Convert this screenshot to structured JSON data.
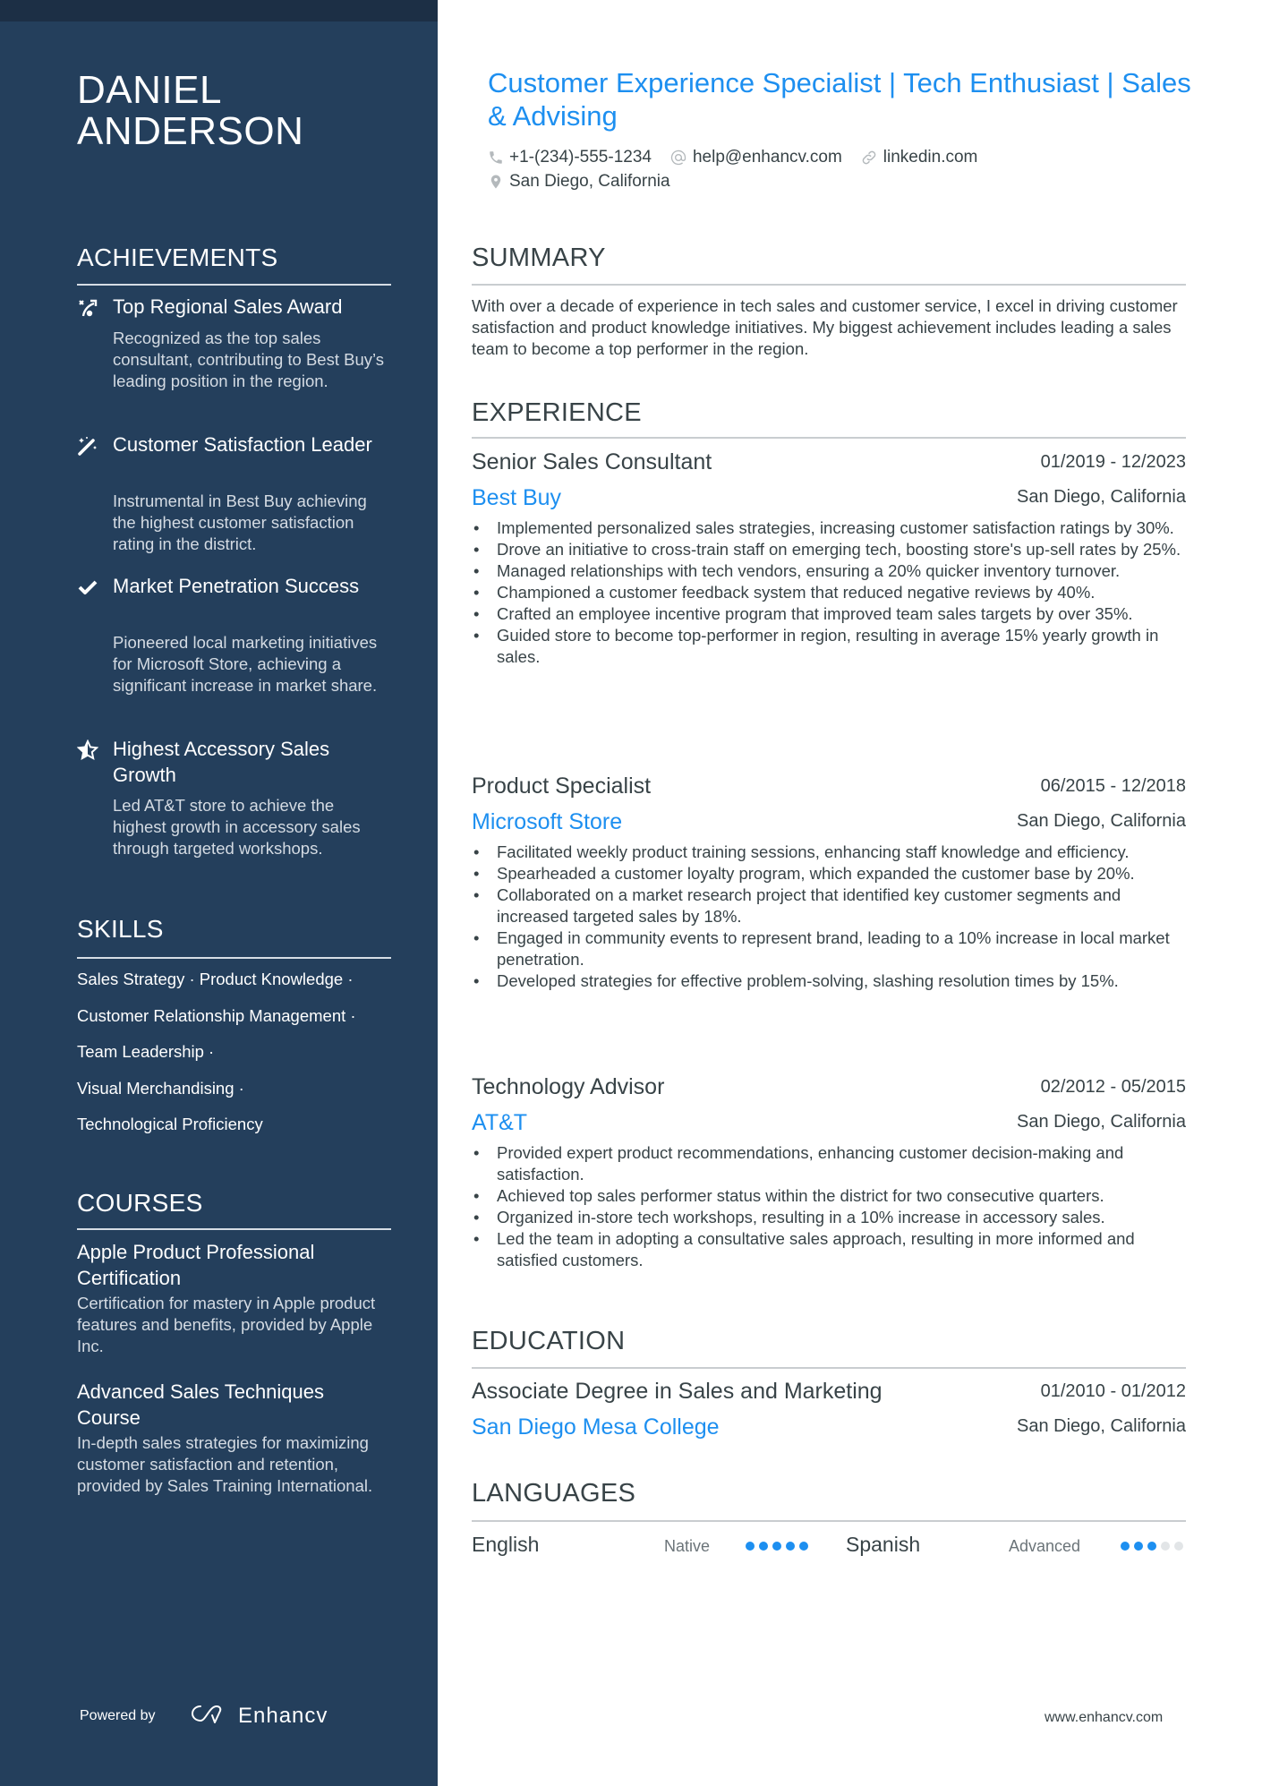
{
  "name": {
    "line1": "DANIEL",
    "line2": "ANDERSON"
  },
  "headline": "Customer Experience Specialist | Tech Enthusiast | Sales & Advising",
  "contact": {
    "phone": "+1-(234)-555-1234",
    "email": "help@enhancv.com",
    "link": "linkedin.com",
    "location": "San Diego, California",
    "icons": {
      "phone": "phone-icon",
      "email": "at-icon",
      "link": "link-icon",
      "location": "map-pin-icon"
    }
  },
  "sidebar": {
    "achievements": {
      "title": "ACHIEVEMENTS",
      "items": [
        {
          "icon": "strategy-icon",
          "title": "Top Regional Sales Award",
          "desc": "Recognized as the top sales consultant, contributing to Best Buy’s leading position in the region."
        },
        {
          "icon": "magic-wand-icon",
          "title": "Customer Satisfaction Leader",
          "desc": "Instrumental in Best Buy achieving the highest customer satisfaction rating in the district."
        },
        {
          "icon": "check-icon",
          "title": "Market Penetration Success",
          "desc": "Pioneered local marketing initiatives for Microsoft Store, achieving a significant increase in market share."
        },
        {
          "icon": "star-half-icon",
          "title": "Highest Accessory Sales Growth",
          "desc": "Led AT&T store to achieve the highest growth in accessory sales through targeted workshops."
        }
      ]
    },
    "skills": {
      "title": "SKILLS",
      "lines": [
        "Sales Strategy · Product Knowledge ·",
        "Customer Relationship Management ·",
        "Team Leadership ·",
        "Visual Merchandising ·",
        "Technological Proficiency"
      ]
    },
    "courses": {
      "title": "COURSES",
      "items": [
        {
          "title": "Apple Product Professional Certification",
          "desc": "Certification for mastery in Apple product features and benefits, provided by Apple Inc."
        },
        {
          "title": "Advanced Sales Techniques Course",
          "desc": "In-depth sales strategies for maximizing customer satisfaction and retention, provided by Sales Training International."
        }
      ]
    },
    "powered_by": "Powered by",
    "brand": "Enhancv"
  },
  "summary": {
    "title": "SUMMARY",
    "text": "With over a decade of experience in tech sales and customer service, I excel in driving customer satisfaction and product knowledge initiatives. My biggest achievement includes leading a sales team to become a top performer in the region."
  },
  "experience": {
    "title": "EXPERIENCE",
    "jobs": [
      {
        "role": "Senior Sales Consultant",
        "dates": "01/2019 - 12/2023",
        "company": "Best Buy",
        "location": "San Diego, California",
        "bullets": [
          "Implemented personalized sales strategies, increasing customer satisfaction ratings by 30%.",
          "Drove an initiative to cross-train staff on emerging tech, boosting store's up-sell rates by 25%.",
          "Managed relationships with tech vendors, ensuring a 20% quicker inventory turnover.",
          "Championed a customer feedback system that reduced negative reviews by 40%.",
          "Crafted an employee incentive program that improved team sales targets by over 35%.",
          "Guided store to become top-performer in region, resulting in average 15% yearly growth in sales."
        ]
      },
      {
        "role": "Product Specialist",
        "dates": "06/2015 - 12/2018",
        "company": "Microsoft Store",
        "location": "San Diego, California",
        "bullets": [
          "Facilitated weekly product training sessions, enhancing staff knowledge and efficiency.",
          "Spearheaded a customer loyalty program, which expanded the customer base by 20%.",
          "Collaborated on a market research project that identified key customer segments and increased targeted sales by 18%.",
          "Engaged in community events to represent brand, leading to a 10% increase in local market penetration.",
          "Developed strategies for effective problem-solving, slashing resolution times by 15%."
        ]
      },
      {
        "role": "Technology Advisor",
        "dates": "02/2012 - 05/2015",
        "company": "AT&T",
        "location": "San Diego, California",
        "bullets": [
          "Provided expert product recommendations, enhancing customer decision-making and satisfaction.",
          "Achieved top sales performer status within the district for two consecutive quarters.",
          "Organized in-store tech workshops, resulting in a 10% increase in accessory sales.",
          "Led the team in adopting a consultative sales approach, resulting in more informed and satisfied customers."
        ]
      }
    ]
  },
  "education": {
    "title": "EDUCATION",
    "degree": "Associate Degree in Sales and Marketing",
    "dates": "01/2010 - 01/2012",
    "school": "San Diego Mesa College",
    "location": "San Diego, California"
  },
  "languages": {
    "title": "LANGUAGES",
    "items": [
      {
        "name": "English",
        "level": "Native",
        "rating": 5,
        "max": 5
      },
      {
        "name": "Spanish",
        "level": "Advanced",
        "rating": 3,
        "max": 5
      }
    ]
  },
  "footer": {
    "url": "www.enhancv.com"
  },
  "colors": {
    "sidebar": "#243f5c",
    "accent": "#1d8ff0",
    "text": "#384347"
  }
}
